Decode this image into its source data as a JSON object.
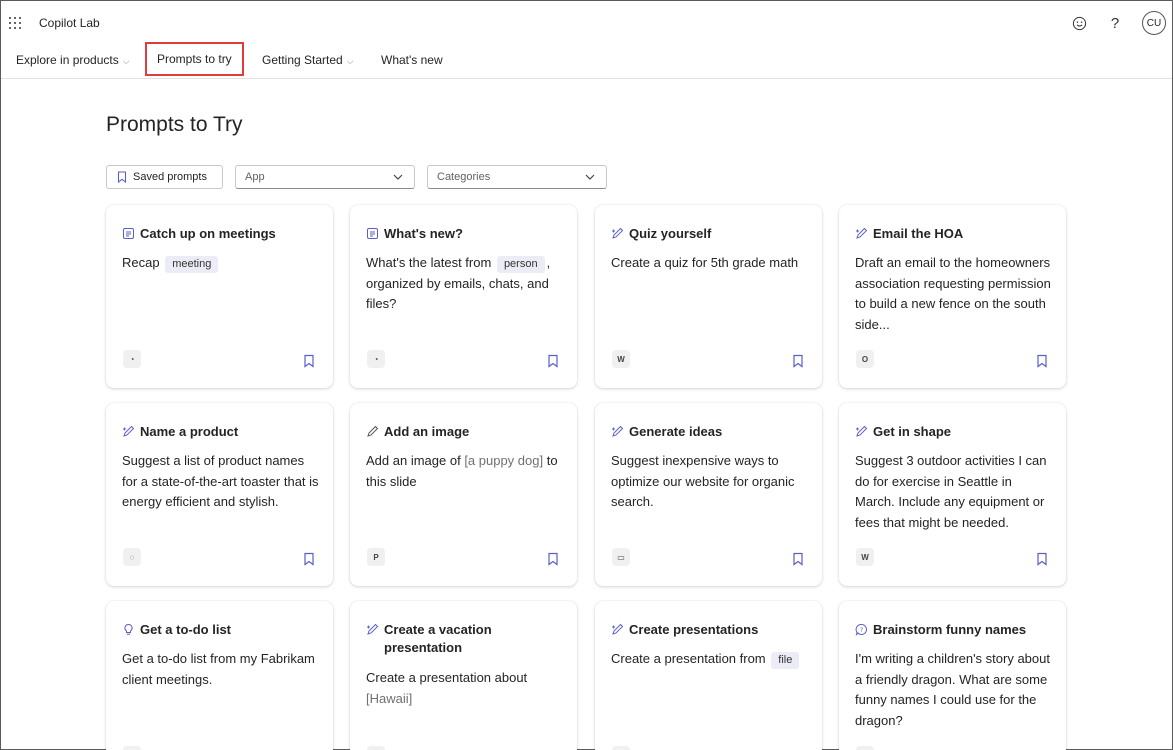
{
  "app": {
    "title": "Copilot Lab",
    "avatar_initials": "CU"
  },
  "icons": {
    "waffle": "app-launcher-icon",
    "feedback": "smiley-icon",
    "help": "help-icon"
  },
  "nav": {
    "items": [
      {
        "label": "Explore in products",
        "has_dropdown": true
      },
      {
        "label": "Prompts to try",
        "has_dropdown": false,
        "active": true
      },
      {
        "label": "Getting Started",
        "has_dropdown": true
      },
      {
        "label": "What's new",
        "has_dropdown": false
      }
    ]
  },
  "page": {
    "title": "Prompts to Try"
  },
  "filters": {
    "saved_label": "Saved prompts",
    "app_placeholder": "App",
    "categories_placeholder": "Categories"
  },
  "colors": {
    "accent": "#5b5fc7",
    "active_outline": "#e03c3c"
  },
  "cards": [
    {
      "title": "Catch up on meetings",
      "icon": "summarize-icon",
      "body": [
        "Recap",
        {
          "chip": "meeting"
        }
      ],
      "app": "copilot"
    },
    {
      "title": "What's new?",
      "icon": "summarize-icon",
      "body": [
        "What's the latest from",
        {
          "chip": "person"
        },
        ", organized by emails, chats, and files?"
      ],
      "app": "copilot"
    },
    {
      "title": "Quiz yourself",
      "icon": "pen-sparkle-icon",
      "body": [
        "Create a quiz for 5th grade math"
      ],
      "app": "word"
    },
    {
      "title": "Email the HOA",
      "icon": "pen-sparkle-icon",
      "body": [
        "Draft an email to the homeowners association requesting permission to build a new fence on the south side..."
      ],
      "app": "outlook"
    },
    {
      "title": "Name a product",
      "icon": "pen-sparkle-icon",
      "body": [
        "Suggest a list of product names for a state-of-the-art toaster that is energy efficient and stylish."
      ],
      "app": "loop"
    },
    {
      "title": "Add an image",
      "icon": "pencil-icon",
      "body": [
        "Add an image of",
        {
          "ph": "[a puppy dog]"
        },
        "to this slide"
      ],
      "app": "powerpoint"
    },
    {
      "title": "Generate ideas",
      "icon": "pen-sparkle-icon",
      "body": [
        "Suggest inexpensive ways to optimize our website for organic search."
      ],
      "app": "whiteboard"
    },
    {
      "title": "Get in shape",
      "icon": "pen-sparkle-icon",
      "body": [
        "Suggest 3 outdoor activities I can do for exercise in Seattle in March. Include any equipment or fees that might be needed."
      ],
      "app": "word"
    },
    {
      "title": "Get a to-do list",
      "icon": "lightbulb-icon",
      "body": [
        "Get a to-do list from my Fabrikam client meetings."
      ],
      "app": "copilot"
    },
    {
      "title": "Create a vacation presentation",
      "icon": "pen-sparkle-icon",
      "body": [
        "Create a presentation about",
        {
          "ph": "[Hawaii]"
        }
      ],
      "app": "powerpoint"
    },
    {
      "title": "Create presentations",
      "icon": "pen-sparkle-icon",
      "body": [
        "Create a presentation from",
        {
          "chip": "file"
        }
      ],
      "app": "powerpoint"
    },
    {
      "title": "Brainstorm funny names",
      "icon": "question-bubble-icon",
      "body": [
        "I'm writing a children's story about a friendly dragon. What are some funny names I could use for the dragon?"
      ],
      "app": "copilot"
    }
  ]
}
